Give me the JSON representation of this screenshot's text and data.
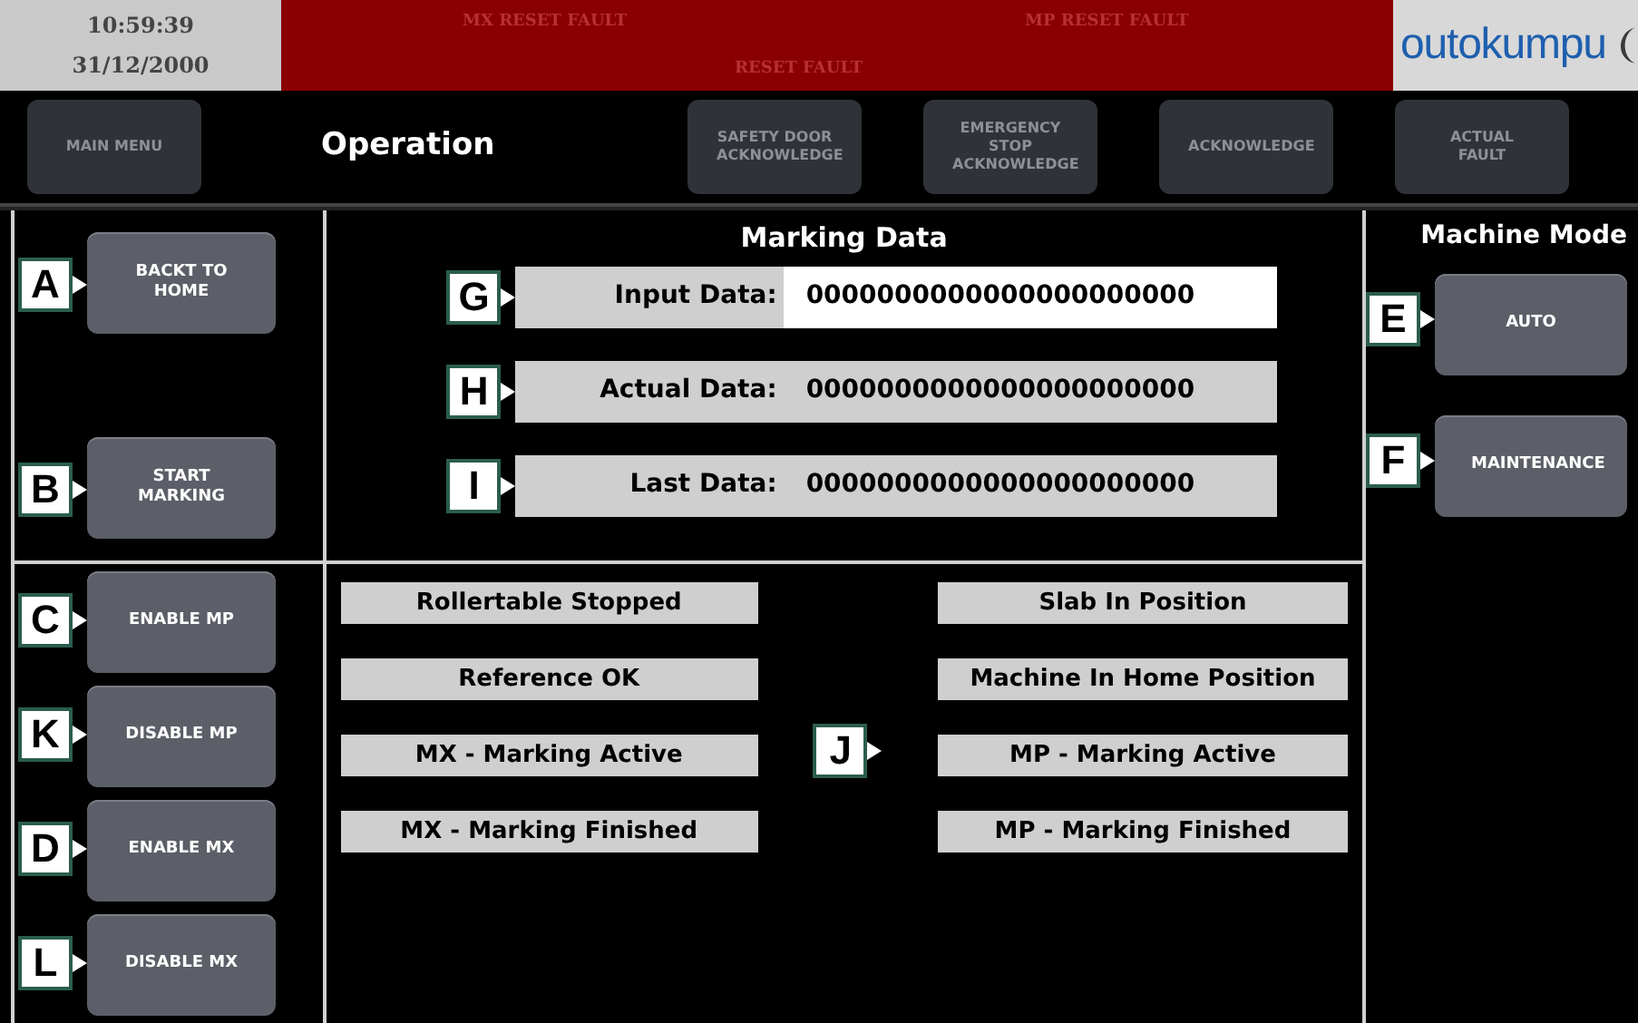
{
  "header": {
    "time": "10:59:39",
    "date": "31/12/2000",
    "faults": [
      "MX RESET FAULT",
      "RESET FAULT",
      "MP RESET FAULT"
    ],
    "logo": "outokumpu"
  },
  "nav": {
    "buttons": [
      {
        "label": "MAIN MENU"
      },
      {
        "kind": "title",
        "label": "Operation"
      },
      {
        "label": "SAFETY DOOR ACKNOWLEDGE"
      },
      {
        "label": "EMERGENCY STOP ACKNOWLEDGE"
      },
      {
        "label": "ACKNOWLEDGE"
      },
      {
        "label": "ACTUAL FAULT"
      }
    ]
  },
  "left_top": [
    {
      "callout": "A",
      "label": "BACKT TO HOME"
    },
    {
      "callout": "B",
      "label": "START MARKING"
    }
  ],
  "left_bottom": [
    {
      "callout": "C",
      "label": "ENABLE MP"
    },
    {
      "callout": "K",
      "label": "DISABLE MP"
    },
    {
      "callout": "D",
      "label": "ENABLE MX"
    },
    {
      "callout": "L",
      "label": "DISABLE MX"
    }
  ],
  "marking_data": {
    "title": "Marking Data",
    "rows": [
      {
        "callout": "G",
        "label": "Input Data:",
        "value": "0000000000000000000000",
        "editable": true
      },
      {
        "callout": "H",
        "label": "Actual Data:",
        "value": "0000000000000000000000",
        "editable": false
      },
      {
        "callout": "I",
        "label": "Last Data:",
        "value": "0000000000000000000000",
        "editable": false
      }
    ]
  },
  "status": {
    "callout": "J",
    "left": [
      "Rollertable Stopped",
      "Reference OK",
      "MX - Marking Active",
      "MX - Marking Finished"
    ],
    "right": [
      "Slab In Position",
      "Machine In Home Position",
      "MP - Marking Active",
      "MP - Marking Finished"
    ]
  },
  "machine_mode": {
    "title": "Machine Mode",
    "buttons": [
      {
        "callout": "E",
        "label": "AUTO"
      },
      {
        "callout": "F",
        "label": "MAINTENANCE"
      }
    ]
  }
}
